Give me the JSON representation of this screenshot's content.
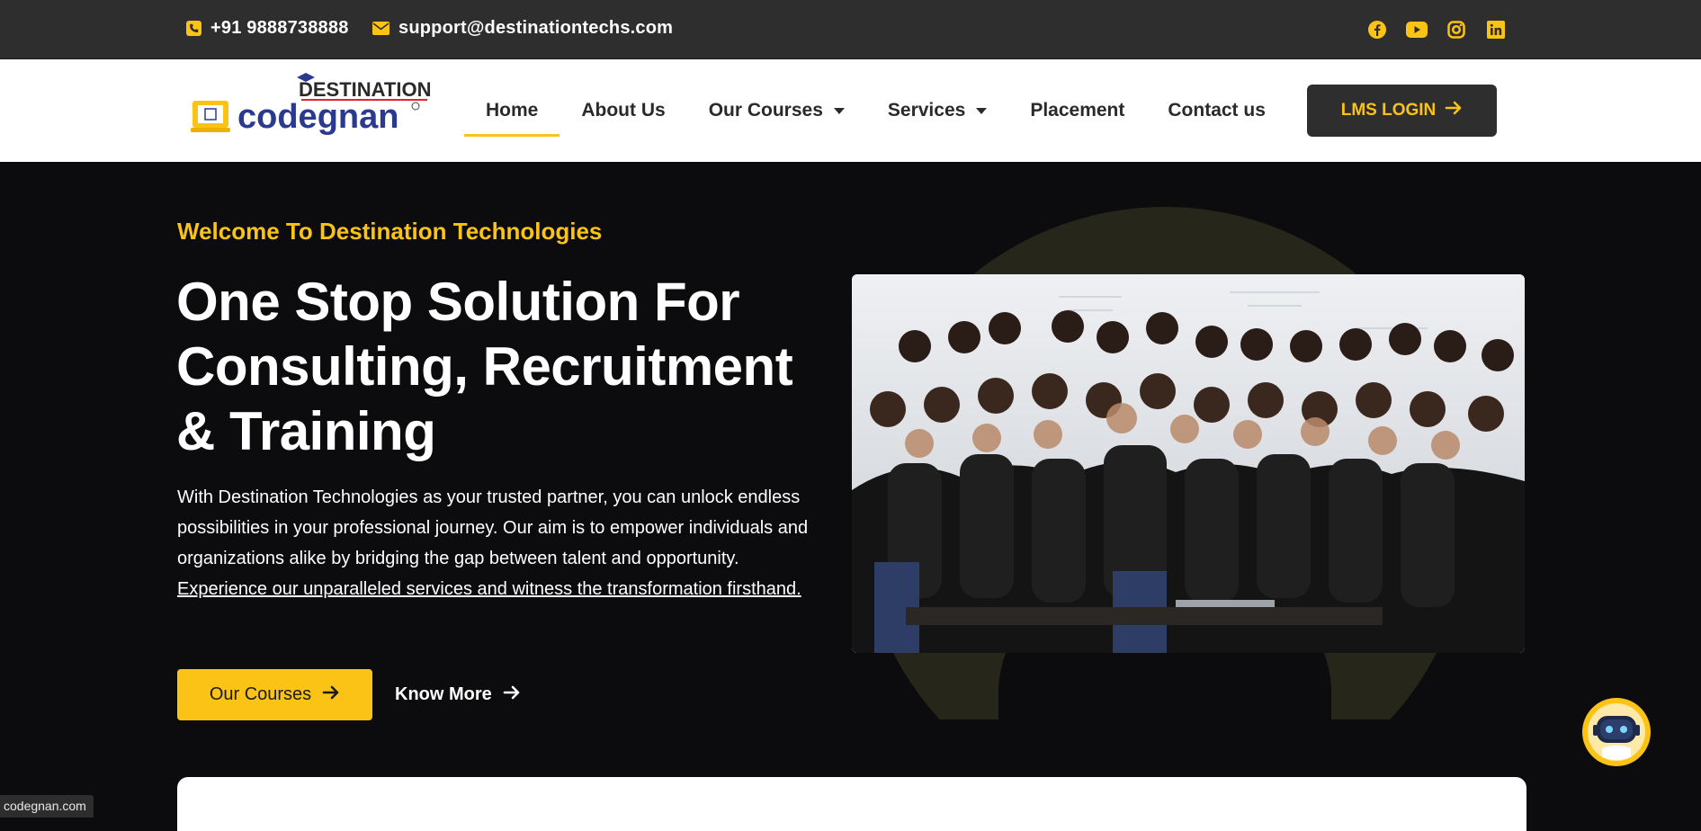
{
  "topbar": {
    "phone": "+91 9888738888",
    "email": "support@destinationtechs.com",
    "socials": [
      "facebook-icon",
      "youtube-icon",
      "instagram-icon",
      "linkedin-icon"
    ]
  },
  "brand": {
    "logo_top": "DESTINATION",
    "logo_main": "codegnan"
  },
  "nav": {
    "items": [
      {
        "label": "Home",
        "active": true
      },
      {
        "label": "About Us"
      },
      {
        "label": "Our Courses",
        "dropdown": true
      },
      {
        "label": "Services",
        "dropdown": true
      },
      {
        "label": "Placement"
      },
      {
        "label": "Contact us"
      }
    ],
    "lms_login": "LMS LOGIN"
  },
  "hero": {
    "welcome": "Welcome To Destination Technologies",
    "headline_line1": "One Stop Solution For",
    "headline_line2": "Consulting, Recruitment",
    "headline_line3": "& Training",
    "description": "With Destination Technologies as your trusted partner, you can unlock endless possibilities in your professional journey. Our aim is to empower individuals and organizations alike by bridging the gap between talent and opportunity. ",
    "description_link": "Experience our unparalleled services and witness the transformation firsthand.",
    "btn_courses": "Our Courses",
    "btn_know_more": "Know More"
  },
  "status_url": "codegnan.com",
  "colors": {
    "accent": "#fbc315",
    "dark": "#2e2e2e",
    "hero_bg": "#0c0c0e"
  }
}
